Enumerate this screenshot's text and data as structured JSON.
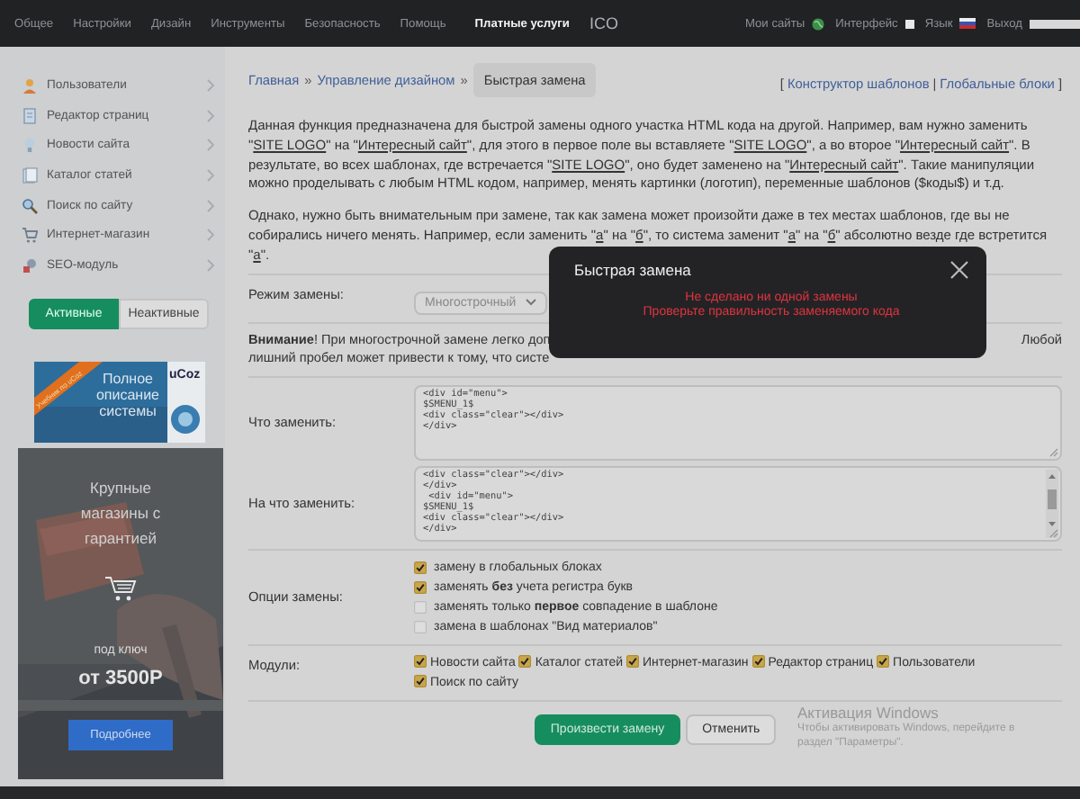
{
  "nav": {
    "items": [
      {
        "label": "Общее",
        "kind": "link",
        "selected": false
      },
      {
        "label": "Настройки",
        "kind": "link",
        "selected": false
      },
      {
        "label": "Дизайн",
        "kind": "link",
        "selected": false
      },
      {
        "label": "Инструменты",
        "kind": "link",
        "selected": false
      },
      {
        "label": "Безопасность",
        "kind": "link",
        "selected": false
      },
      {
        "label": "Помощь",
        "kind": "link",
        "selected": false
      },
      {
        "label": "Платные услуги",
        "kind": "link",
        "selected": true
      },
      {
        "label": "ICO",
        "kind": "logo"
      }
    ],
    "right": [
      {
        "label": "Мои сайты",
        "kind": "globe"
      },
      {
        "label": "Интерфейс",
        "kind": "square"
      },
      {
        "label": "Язык",
        "kind": "flag"
      },
      {
        "label": "Выход",
        "kind": "bar"
      }
    ]
  },
  "sidebar": {
    "items": [
      {
        "label": "Пользователи"
      },
      {
        "label": "Редактор страниц"
      },
      {
        "label": "Новости сайта"
      },
      {
        "label": "Каталог статей"
      },
      {
        "label": "Поиск по сайту"
      },
      {
        "label": "Интернет-магазин"
      },
      {
        "label": "SEO-модуль"
      }
    ],
    "filter_tabs": [
      {
        "label": "Активные",
        "selected": true
      },
      {
        "label": "Неактивные",
        "selected": false
      }
    ],
    "banner": {
      "ribbon": "Учебник по uCoz",
      "text": "Полное описание системы",
      "book": "uCoz"
    },
    "ad": {
      "title": "Крупные магазины с гарантией",
      "subtitle": "под ключ",
      "price": "от 3500Р",
      "button": "Подробнее"
    }
  },
  "breadcrumbs": [
    {
      "label": "Главная",
      "kind": "link"
    },
    {
      "label": "»",
      "kind": "sep"
    },
    {
      "label": "Управление дизайном",
      "kind": "link"
    },
    {
      "label": "»",
      "kind": "sep"
    },
    {
      "label": "Быстрая замена",
      "kind": "current"
    }
  ],
  "header_links": {
    "open": "[",
    "links": [
      "Конструктор шаблонов",
      "Глобальные блоки"
    ],
    "separator": "|",
    "close": "]"
  },
  "intro": [
    [
      {
        "text": "Данная функция предназначена для быстрой замены одного участка HTML кода на другой. Например, вам нужно заменить \"",
        "kind": "plain"
      },
      {
        "text": "SITE LOGO",
        "kind": "underline"
      },
      {
        "text": "\" на \"",
        "kind": "plain"
      },
      {
        "text": "Интересный сайт",
        "kind": "underline"
      },
      {
        "text": "\", для этого в первое поле вы вставляете \"",
        "kind": "plain"
      },
      {
        "text": "SITE LOGO",
        "kind": "underline"
      },
      {
        "text": "\", а во второе \"",
        "kind": "plain"
      },
      {
        "text": "Интересный сайт",
        "kind": "underline"
      },
      {
        "text": "\". В результате, во всех шаблонах, где встречается \"",
        "kind": "plain"
      },
      {
        "text": "SITE LOGO",
        "kind": "underline"
      },
      {
        "text": "\", оно будет заменено на \"",
        "kind": "plain"
      },
      {
        "text": "Интересный сайт",
        "kind": "underline"
      },
      {
        "text": "\". Такие манипуляции можно проделывать с любым HTML кодом, например, менять картинки (логотип), переменные шаблонов ($коды$) и т.д.",
        "kind": "plain"
      }
    ],
    [
      {
        "text": "Однако, нужно быть внимательным при замене, так как замена может произойти даже в тех местах шаблонов, где вы не собирались ничего менять. Например, если заменить \"",
        "kind": "plain"
      },
      {
        "text": "а",
        "kind": "underline"
      },
      {
        "text": "\" на \"",
        "kind": "plain"
      },
      {
        "text": "б",
        "kind": "underline"
      },
      {
        "text": "\", то система заменит \"",
        "kind": "plain"
      },
      {
        "text": "а",
        "kind": "underline"
      },
      {
        "text": "\" на \"",
        "kind": "plain"
      },
      {
        "text": "б",
        "kind": "underline"
      },
      {
        "text": "\" абсолютно везде где встретится \"",
        "kind": "plain"
      },
      {
        "text": "а",
        "kind": "underline"
      },
      {
        "text": "\".",
        "kind": "plain"
      }
    ]
  ],
  "mode": {
    "label": "Режим замены:",
    "value": "Многострочный"
  },
  "warning": {
    "line1_left": "**Внимание**! При многострочной замене легко доп",
    "line1_right": "Любой",
    "line2_left": "лишний пробел может привести к тому, что систе"
  },
  "find": {
    "label": "Что заменить:",
    "value": "<div id=\"menu\">\n$SMENU_1$\n<div class=\"clear\"></div>\n</div>"
  },
  "replace": {
    "label": "На что заменить:",
    "value": "<div class=\"clear\"></div>\n</div>\n <div id=\"menu\">\n$SMENU_1$\n<div class=\"clear\"></div>\n</div>"
  },
  "options": {
    "label": "Опции замены:",
    "items": [
      {
        "text": "замену в глобальных блоках",
        "checked": true
      },
      {
        "text": "заменять **без** учета регистра букв",
        "checked": true
      },
      {
        "text": "заменять только **первое** совпадение в шаблоне",
        "checked": false
      },
      {
        "text": "замена в шаблонах \"Вид материалов\"",
        "checked": false
      }
    ]
  },
  "modules": {
    "label": "Модули:",
    "items": [
      {
        "text": "Новости сайта",
        "checked": true
      },
      {
        "text": "Каталог статей",
        "checked": true
      },
      {
        "text": "Интернет-магазин",
        "checked": true
      },
      {
        "text": "Редактор страниц",
        "checked": true
      },
      {
        "text": "Пользователи",
        "checked": true
      },
      {
        "text": "Поиск по сайту",
        "checked": true
      }
    ]
  },
  "buttons": [
    {
      "label": "Произвести замену",
      "kind": "primary"
    },
    {
      "label": "Отменить",
      "kind": "secondary"
    }
  ],
  "dialog": {
    "title": "Быстрая замена",
    "messages": [
      "Не сделано ни одной замены",
      "Проверьте правильность заменяемого кода"
    ]
  },
  "windows_activation": {
    "title": "Активация Windows",
    "text": "Чтобы активировать Windows, перейдите в раздел \"Параметры\"."
  }
}
